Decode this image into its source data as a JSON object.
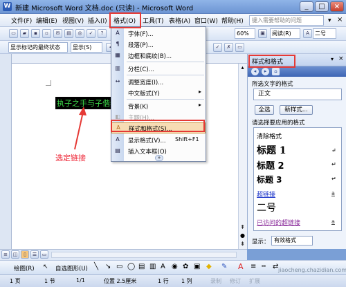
{
  "window": {
    "title": "新建 Microsoft Word 文档.doc (只读) - Microsoft Word",
    "app_icon": "W",
    "minimize": "_",
    "maximize": "□",
    "close": "×"
  },
  "menu": {
    "items": [
      "文件(F)",
      "编辑(E)",
      "视图(V)",
      "插入(I)",
      "格式(O)",
      "工具(T)",
      "表格(A)",
      "窗口(W)",
      "帮助(H)"
    ],
    "ask_placeholder": "键入需要帮助的问题"
  },
  "toolbar1": {
    "zoom": "60%",
    "read_label": "阅读(R)",
    "font_size": "二号"
  },
  "toolbar2": {
    "markup_combo": "显示标记的最终状态",
    "show_button": "显示(S)"
  },
  "document": {
    "selected_link_text": "执子之手与子偕老",
    "annotation": "选定链接"
  },
  "format_menu": {
    "items": [
      {
        "label": "字体(F)...",
        "icon": "A"
      },
      {
        "label": "段落(P)...",
        "icon": "¶"
      },
      {
        "label": "边框和底纹(B)...",
        "icon": "▦"
      },
      {
        "label": "分栏(C)...",
        "icon": "▥"
      },
      {
        "label": "调整宽度(I)...",
        "icon": "↔"
      },
      {
        "label": "中文版式(Y)",
        "icon": ""
      },
      {
        "label": "背景(K)",
        "icon": ""
      },
      {
        "label": "主题(H)...",
        "icon": "◧"
      },
      {
        "label": "样式和格式(S)...",
        "icon": "A"
      },
      {
        "label": "显示格式(V)...",
        "icon": "A",
        "shortcut": "Shift+F1"
      },
      {
        "label": "插入文本框(O)",
        "icon": "▤"
      }
    ],
    "expand": "»"
  },
  "task_pane": {
    "title": "样式和格式",
    "format_label": "所选文字的格式",
    "format_value": "正文",
    "select_all": "全选",
    "new_style": "新样式...",
    "apply_label": "请选择要应用的格式",
    "styles": [
      {
        "name": "清除格式",
        "mark": ""
      },
      {
        "name": "标题 1",
        "mark": "↵"
      },
      {
        "name": "标题 2",
        "mark": "↵"
      },
      {
        "name": "标题 3",
        "mark": "↵"
      },
      {
        "name": "超链接",
        "mark": "a"
      },
      {
        "name": "二号",
        "mark": ""
      },
      {
        "name": "已访问的超链接",
        "mark": "a"
      }
    ],
    "show_label": "显示：",
    "show_value": "有效格式"
  },
  "drawing_toolbar": {
    "draw_label": "绘图(R)",
    "autoshape_label": "自选图形(U)"
  },
  "status_bar": {
    "page": "1 页",
    "section": "1 节",
    "page_of": "1/1",
    "position": "位置 2.5厘米",
    "line": "1 行",
    "column": "1 列",
    "rec": "录制",
    "trk": "修订",
    "ext": "扩展"
  },
  "watermark": "jiaocheng.chazidian.com"
}
